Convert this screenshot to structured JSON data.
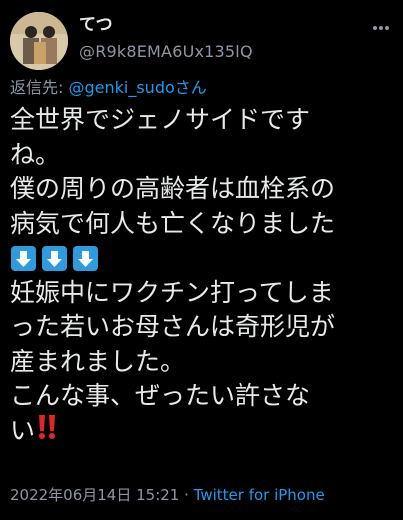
{
  "user": {
    "display_name": "てつ",
    "handle": "@R9k8EMA6Ux135lQ"
  },
  "reply": {
    "prefix": "返信先: ",
    "mention": "@genki_sudoさん"
  },
  "tweet": {
    "lines": [
      "全世界でジェノサイドです",
      "ね。",
      "僕の周りの高齢者は血栓系の",
      "病気で何人も亡くなりました",
      "妊娠中にワクチン打ってしま",
      "った若いお母さんは奇形児が",
      "産まれました。",
      "こんな事、ぜったい許さな",
      "い"
    ],
    "emoji": [
      "arrow-down-box-emoji",
      "arrow-down-box-emoji",
      "arrow-down-box-emoji",
      "double-exclamation-emoji"
    ]
  },
  "meta": {
    "datetime": "2022年06月14日 15:21",
    "separator": " · ",
    "source": "Twitter for iPhone"
  },
  "colors": {
    "background": "#000000",
    "text": "#e7e9ea",
    "secondary": "#8b98a5",
    "link": "#1d9bf0",
    "emoji_box": "#2f9bdc",
    "exclamation": "#e0242a"
  }
}
